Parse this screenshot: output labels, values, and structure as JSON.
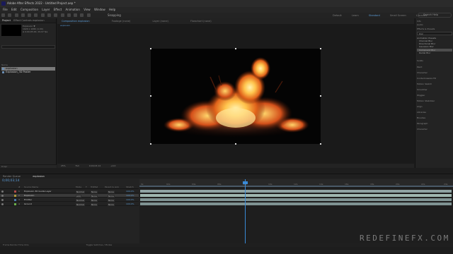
{
  "window": {
    "title": "Adobe After Effects 2022 - Untitled Project.aep *"
  },
  "menu": [
    "File",
    "Edit",
    "Composition",
    "Layer",
    "Effect",
    "Animation",
    "View",
    "Window",
    "Help"
  ],
  "toolbar": {
    "snapping_label": "Snapping",
    "search_placeholder": "Search Help"
  },
  "workspaces": [
    {
      "label": "Default",
      "active": false
    },
    {
      "label": "Learn",
      "active": false
    },
    {
      "label": "Standard",
      "active": true
    },
    {
      "label": "Small Screen",
      "active": false
    },
    {
      "label": "Libraries",
      "active": false
    }
  ],
  "project_panel": {
    "tabs": [
      "Project",
      "Effect Controls explosion"
    ],
    "thumb_info": [
      "Explosion ▼",
      "1920 x 1080 (1.00)",
      "Δ 0;00;05;00, 29.97 fps"
    ],
    "header": "Name",
    "items": [
      "explosion",
      "Explosion_3D Poster"
    ],
    "footer": "8 bpc"
  },
  "viewer": {
    "tabs": [
      "Composition explosion",
      "Footage (none)",
      "Layer (none)",
      "Flowchart (none)"
    ],
    "sub_tab": "explosion",
    "controls": [
      "25%",
      "Full",
      "0;00;03;14",
      "+0.0"
    ]
  },
  "right_panel": {
    "items": [
      "Info",
      "Audio",
      "Effects & Presets",
      "Animation Presets",
      "Channel Blur",
      "Directional Blur",
      "Gaussian Blur",
      "Compound Blur",
      "Radial Blur",
      "Solids",
      "Paint",
      "Character",
      "Content-Aware Fill",
      "Motion Sketch",
      "Smoother",
      "Wiggler",
      "Motion Stabilizer",
      "Align",
      "Libraries",
      "Brushes",
      "Paragraph",
      "Character"
    ],
    "effects_search_placeholder": "blur"
  },
  "timeline": {
    "tabs": [
      "Render Queue",
      "explosion"
    ],
    "timecode": "0;00;03;14",
    "columns": [
      "#",
      "Source Name",
      "Mode",
      "T",
      "TrkMat",
      "Parent & Link",
      "Stretch"
    ],
    "layers": [
      {
        "num": "1",
        "name": "Explosion 3D Guide Layer",
        "mode": "Normal",
        "trkmat": "None",
        "parent": "None",
        "stretch": "100.0%",
        "color": "#b04a4a"
      },
      {
        "num": "2",
        "name": "Explosion",
        "mode": "Add",
        "trkmat": "None",
        "parent": "None",
        "stretch": "100.0%",
        "color": "#b09a3a"
      },
      {
        "num": "3",
        "name": "Emitter",
        "mode": "Normal",
        "trkmat": "None",
        "parent": "None",
        "stretch": "100.0%",
        "color": "#4a7ab0"
      },
      {
        "num": "4",
        "name": "Ground",
        "mode": "Normal",
        "trkmat": "None",
        "parent": "None",
        "stretch": "100.0%",
        "color": "#6ab04a"
      }
    ],
    "ruler": [
      "0s",
      "02s",
      "04s",
      "06s",
      "08s",
      "10s",
      "12s",
      "14s",
      "16s",
      "18s",
      "20s",
      "22s",
      "24s"
    ],
    "footer_left": "Frame Render Time  0ms",
    "footer_mid": "Toggle Switches / Modes"
  },
  "watermark": "REDEFINEFX.COM",
  "colors": {
    "accent": "#5b9bd5",
    "playhead": "#3a8ad6"
  }
}
